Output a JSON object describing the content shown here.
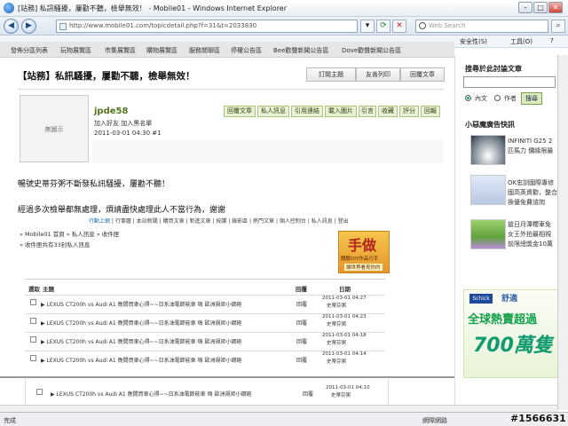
{
  "browser": {
    "title": "[站務] 私訊騷擾，屢勸不聽，檢舉無效！ - Mobile01 - Windows Internet Explorer",
    "url": "http://www.mobile01.com/topicdetail.php?f=31&t=2033830",
    "search_placeholder": "Web Search",
    "command_items": [
      "安全性(S)",
      "工具(O)",
      "?"
    ],
    "status": "完成",
    "zone": "網際網路"
  },
  "forum_nav": [
    "發佈分區列表",
    "玩物展覽區",
    "市集展覽區",
    "購物展覽區",
    "服務閒聊區",
    "停權公告區",
    "Bee歡聲新聞公告區",
    "Dove歡聲新聞公告區"
  ],
  "topic": {
    "title": "【站務】私訊騷擾，屢勸不聽，檢舉無效！",
    "buttons": [
      "訂閱主題",
      "友善列印",
      "回覆文章"
    ]
  },
  "post": {
    "avatar_label": "無圖示",
    "username": "jpde58",
    "user_links": "加入好友  加入黑名單",
    "date": "2011-03-01 04:30  #1",
    "actions": [
      "回覆文章",
      "私人訊息",
      "引用連結",
      "載入圖片",
      "引言",
      "收藏",
      "評分",
      "回報"
    ],
    "body_line1": "暢號史蒂芬粥不斷發私訊騷擾，屢勸不聽！",
    "body_line2": "經過多次檢舉都無處理，煩請盡快處理此人不當行為，謝謝",
    "link_row": [
      "行動上網",
      "行事曆",
      "本站新聞",
      "購買文章",
      "新進文章",
      "按讚",
      "錄影區",
      "熱門文章",
      "個人控制台",
      "私人訊息",
      "登出"
    ],
    "breadcrumb": "» Mobile01 首頁 » 私人訊息 » 收件匣",
    "inbox_count": "» 收件匣共有33封私人訊息"
  },
  "promo": {
    "big": "手做",
    "line1": "體驗DIY作品巧手",
    "line2": "讓世界看見你的"
  },
  "inbox": {
    "headers": [
      "選取",
      "主題",
      "回覆",
      "日期"
    ],
    "rows": [
      {
        "subject": "▶ LEXUS CT200h vs Audi A1 晚間買車心得~~日系油電節能車 嗨 歐洲規矩小鋼砲",
        "reply": "回覆",
        "date": "2011-03-01 04:27",
        "author": "史蒂芬粥"
      },
      {
        "subject": "▶ LEXUS CT200h vs Audi A1 晚間買車心得~~日系油電節能車 嗨 歐洲規矩小鋼砲",
        "reply": "回覆",
        "date": "2011-03-01 04:23",
        "author": "史蒂芬粥"
      },
      {
        "subject": "▶ LEXUS CT200h vs Audi A1 晚間買車心得~~日系油電節能車 嗨 歐洲規矩小鋼砲",
        "reply": "回覆",
        "date": "2011-03-01 04:18",
        "author": "史蒂芬粥"
      },
      {
        "subject": "▶ LEXUS CT200h vs Audi A1 晚間買車心得~~日系油電節能車 嗨 歐洲規矩小鋼砲",
        "reply": "回覆",
        "date": "2011-03-01 04:14",
        "author": "史蒂芬粥"
      }
    ],
    "overlay_row": {
      "subject": "▶ LEXUS CT200h vs Audi A1 晚間買車心得~~日系油電節能車 嗨 歐洲規矩小鋼砲",
      "reply": "回覆",
      "date": "2011-03-01 04:10",
      "author": "史蒂芬粥"
    }
  },
  "sidebar": {
    "search_title": "搜尋於此討論文章",
    "radio_content": "內文",
    "radio_author": "作者",
    "search_button": "搜尋",
    "news_title": "小惡魔廣告快訊",
    "news": [
      {
        "line1": "INFINITI G25 2",
        "line2": "匹馬力 價緣限最"
      },
      {
        "line1": "OK忠訓國際專修",
        "line2": "國高英資歡，整合",
        "line3": "換優免費諮詢"
      },
      {
        "line1": "搶日月潭櫻車免",
        "line2": "女王外拍最相視",
        "line3": "前限總獎金10萬"
      }
    ],
    "banner_logo": "Schick",
    "banner_brand": "舒適",
    "banner_line1": "全球熱賣超過",
    "banner_line2": "700萬隻"
  },
  "watermark": "#1566631"
}
